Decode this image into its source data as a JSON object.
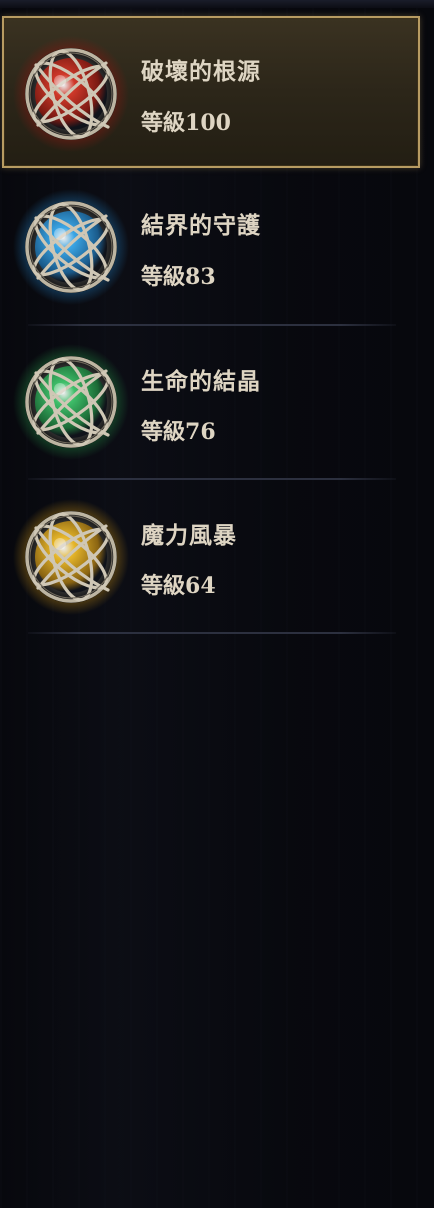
{
  "skills": [
    {
      "name": "破壞的根源",
      "level_label": "等級",
      "level_value": "100",
      "color": "#d0392a",
      "glow": "#7a1a12",
      "selected": true
    },
    {
      "name": "結界的守護",
      "level_label": "等級",
      "level_value": "83",
      "color": "#3aa6e6",
      "glow": "#1a5a8a",
      "selected": false
    },
    {
      "name": "生命的結晶",
      "level_label": "等級",
      "level_value": "76",
      "color": "#3fbf6a",
      "glow": "#1c6a36",
      "selected": false
    },
    {
      "name": "魔力風暴",
      "level_label": "等級",
      "level_value": "64",
      "color": "#e6b62a",
      "glow": "#8a6412",
      "selected": false
    }
  ]
}
